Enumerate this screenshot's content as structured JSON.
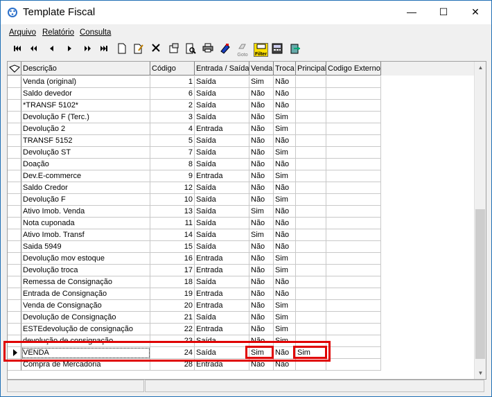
{
  "window": {
    "title": "Template Fiscal",
    "min_glyph": "—",
    "max_glyph": "☐",
    "close_glyph": "✕"
  },
  "menu": [
    {
      "label": "Arquivo"
    },
    {
      "label": "Relatório"
    },
    {
      "label": "Consulta"
    }
  ],
  "toolbar": {
    "goto_label": "Goto",
    "filter_label": "Filter"
  },
  "grid": {
    "columns": [
      "Descrição",
      "Código",
      "Entrada / Saída",
      "Venda",
      "Troca",
      "Principal",
      "Codigo Externo"
    ],
    "rows": [
      {
        "descricao": "Venda (original)",
        "codigo": "1",
        "es": "Saída",
        "venda": "Sim",
        "troca": "Não",
        "principal": "",
        "externo": ""
      },
      {
        "descricao": "Saldo devedor",
        "codigo": "6",
        "es": "Saída",
        "venda": "Não",
        "troca": "Não",
        "principal": "",
        "externo": ""
      },
      {
        "descricao": "*TRANSF 5102*",
        "codigo": "2",
        "es": "Saída",
        "venda": "Não",
        "troca": "Não",
        "principal": "",
        "externo": ""
      },
      {
        "descricao": "Devolução F (Terc.)",
        "codigo": "3",
        "es": "Saída",
        "venda": "Não",
        "troca": "Sim",
        "principal": "",
        "externo": ""
      },
      {
        "descricao": "Devolução 2",
        "codigo": "4",
        "es": "Entrada",
        "venda": "Não",
        "troca": "Sim",
        "principal": "",
        "externo": ""
      },
      {
        "descricao": "TRANSF 5152",
        "codigo": "5",
        "es": "Saída",
        "venda": "Não",
        "troca": "Não",
        "principal": "",
        "externo": ""
      },
      {
        "descricao": "Devolução ST",
        "codigo": "7",
        "es": "Saída",
        "venda": "Não",
        "troca": "Sim",
        "principal": "",
        "externo": ""
      },
      {
        "descricao": "Doação",
        "codigo": "8",
        "es": "Saída",
        "venda": "Não",
        "troca": "Não",
        "principal": "",
        "externo": ""
      },
      {
        "descricao": "Dev.E-commerce",
        "codigo": "9",
        "es": "Entrada",
        "venda": "Não",
        "troca": "Sim",
        "principal": "",
        "externo": ""
      },
      {
        "descricao": "Saldo Credor",
        "codigo": "12",
        "es": "Saída",
        "venda": "Não",
        "troca": "Não",
        "principal": "",
        "externo": ""
      },
      {
        "descricao": "Devolução F",
        "codigo": "10",
        "es": "Saída",
        "venda": "Não",
        "troca": "Sim",
        "principal": "",
        "externo": ""
      },
      {
        "descricao": "Ativo Imob. Venda",
        "codigo": "13",
        "es": "Saída",
        "venda": "Sim",
        "troca": "Não",
        "principal": "",
        "externo": ""
      },
      {
        "descricao": "Nota cuponada",
        "codigo": "11",
        "es": "Saída",
        "venda": "Não",
        "troca": "Não",
        "principal": "",
        "externo": ""
      },
      {
        "descricao": "Ativo Imob. Transf",
        "codigo": "14",
        "es": "Saída",
        "venda": "Sim",
        "troca": "Não",
        "principal": "",
        "externo": ""
      },
      {
        "descricao": "Saida 5949",
        "codigo": "15",
        "es": "Saída",
        "venda": "Não",
        "troca": "Não",
        "principal": "",
        "externo": ""
      },
      {
        "descricao": "Devolução mov estoque",
        "codigo": "16",
        "es": "Entrada",
        "venda": "Não",
        "troca": "Sim",
        "principal": "",
        "externo": ""
      },
      {
        "descricao": "Devolução troca",
        "codigo": "17",
        "es": "Entrada",
        "venda": "Não",
        "troca": "Sim",
        "principal": "",
        "externo": ""
      },
      {
        "descricao": "Remessa de Consignação",
        "codigo": "18",
        "es": "Saída",
        "venda": "Não",
        "troca": "Não",
        "principal": "",
        "externo": ""
      },
      {
        "descricao": "Entrada de Consignação",
        "codigo": "19",
        "es": "Entrada",
        "venda": "Não",
        "troca": "Não",
        "principal": "",
        "externo": ""
      },
      {
        "descricao": "Venda de Consignação",
        "codigo": "20",
        "es": "Entrada",
        "venda": "Não",
        "troca": "Sim",
        "principal": "",
        "externo": ""
      },
      {
        "descricao": "Devolução de Consignação",
        "codigo": "21",
        "es": "Saída",
        "venda": "Não",
        "troca": "Sim",
        "principal": "",
        "externo": ""
      },
      {
        "descricao": "ESTEdevolução de consignação",
        "codigo": "22",
        "es": "Entrada",
        "venda": "Não",
        "troca": "Sim",
        "principal": "",
        "externo": ""
      },
      {
        "descricao": "devolução de consignação",
        "codigo": "23",
        "es": "Saída",
        "venda": "Não",
        "troca": "Sim",
        "principal": "",
        "externo": ""
      },
      {
        "descricao": "VENDA",
        "codigo": "24",
        "es": "Saída",
        "venda": "Sim",
        "troca": "Não",
        "principal": "Sim",
        "externo": "",
        "selected": true
      },
      {
        "descricao": "Compra de Mercadoria",
        "codigo": "28",
        "es": "Entrada",
        "venda": "Não",
        "troca": "Não",
        "principal": "",
        "externo": ""
      }
    ]
  },
  "colors": {
    "highlight": "#e00000",
    "window_border": "#1f6fb5"
  }
}
